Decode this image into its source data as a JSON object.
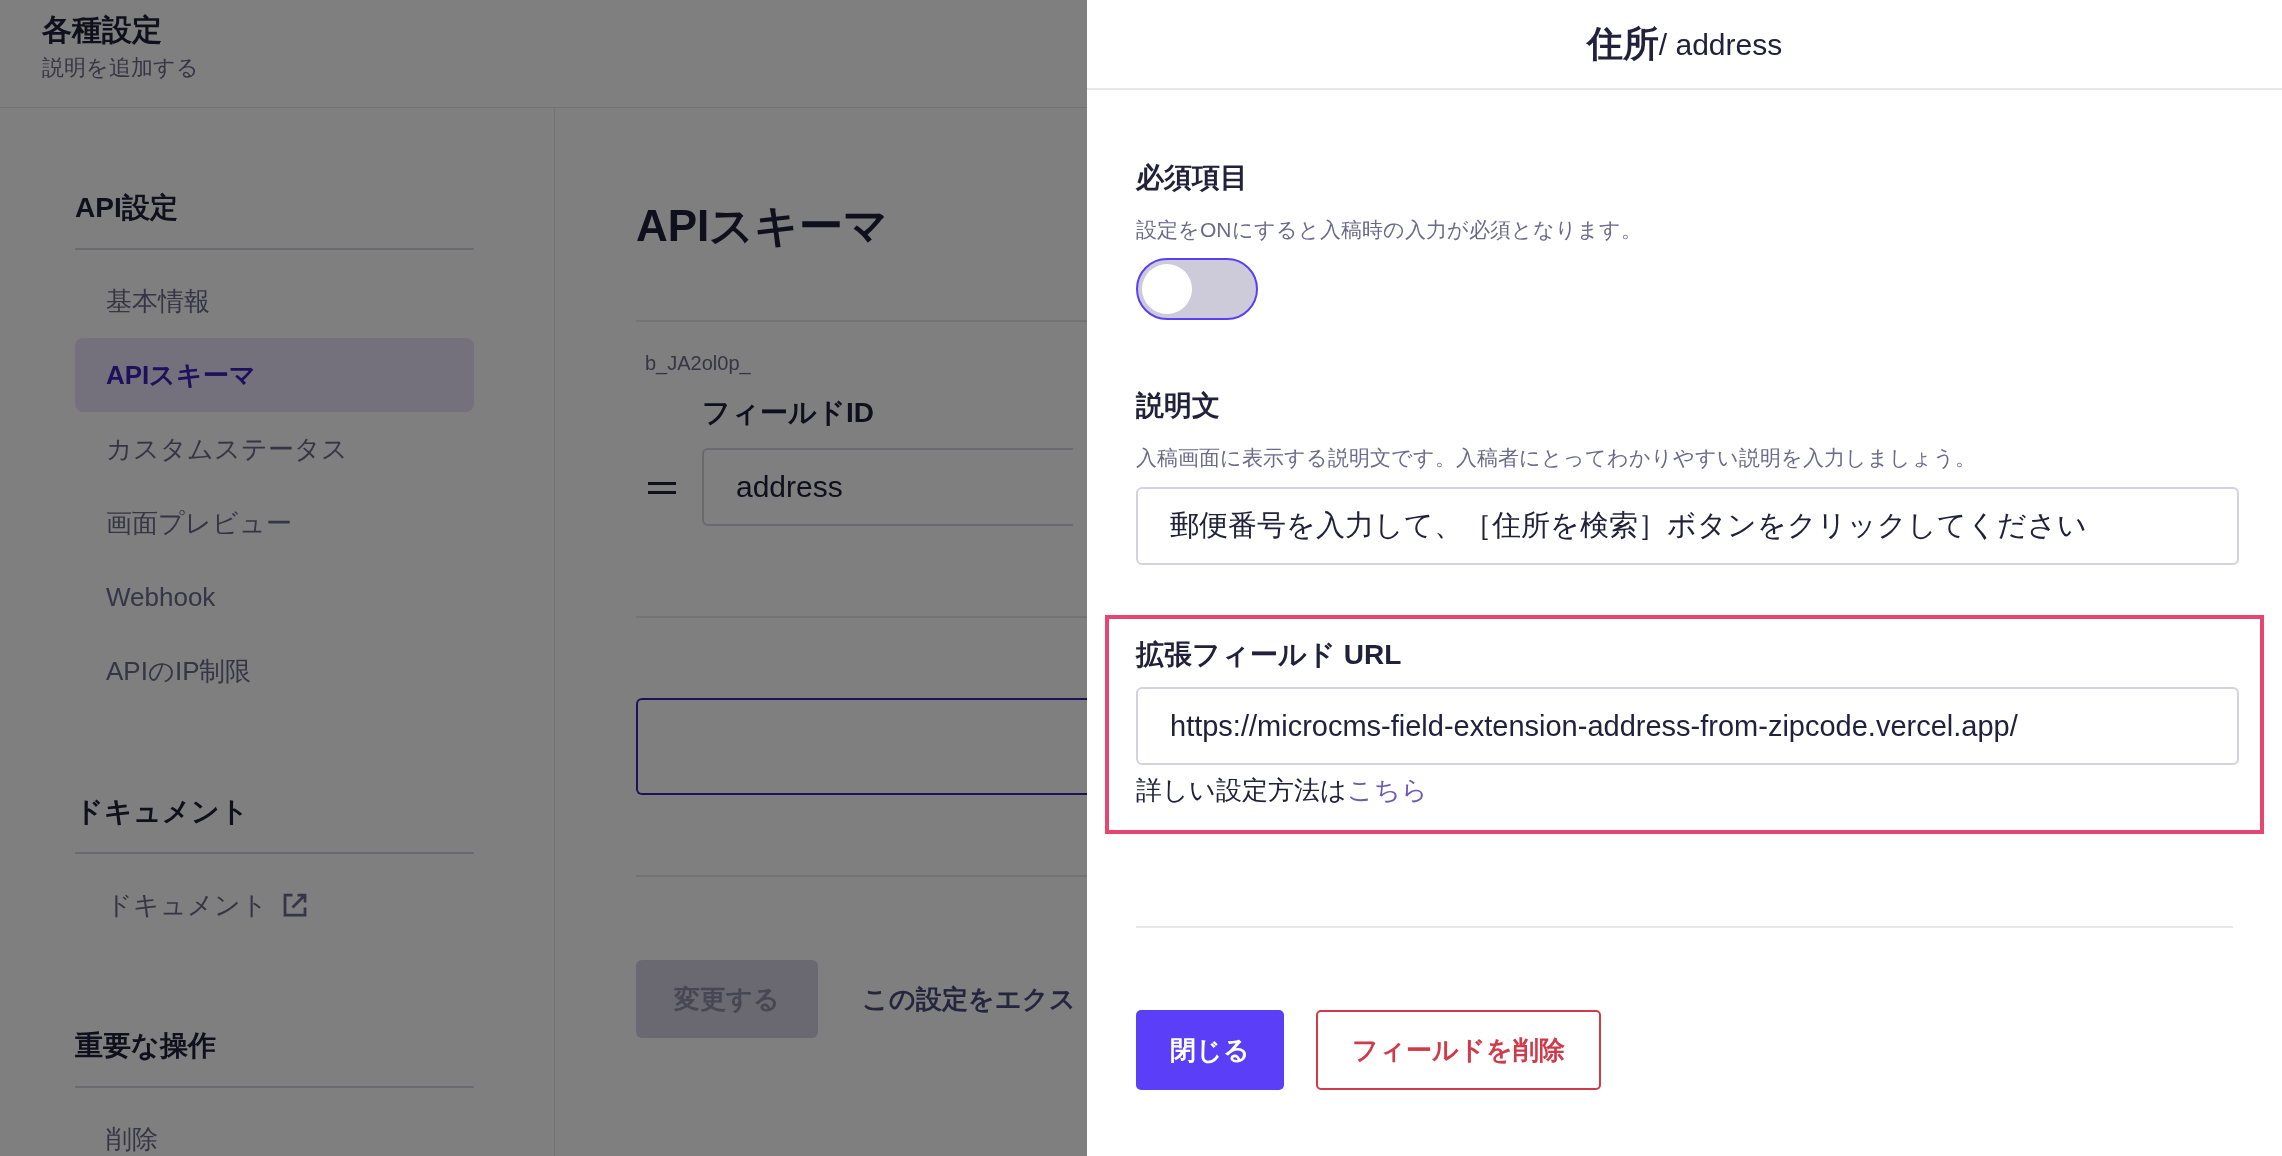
{
  "page": {
    "title": "各種設定",
    "subtitle": "説明を追加する"
  },
  "sidebar": {
    "sections": [
      {
        "heading": "API設定",
        "items": [
          {
            "label": "基本情報",
            "selected": false
          },
          {
            "label": "APIスキーマ",
            "selected": true
          },
          {
            "label": "カスタムステータス",
            "selected": false
          },
          {
            "label": "画面プレビュー",
            "selected": false
          },
          {
            "label": "Webhook",
            "selected": false
          },
          {
            "label": "APIのIP制限",
            "selected": false
          }
        ]
      },
      {
        "heading": "ドキュメント",
        "items": [
          {
            "label": "ドキュメント",
            "selected": false,
            "external": true
          }
        ]
      },
      {
        "heading": "重要な操作",
        "items": [
          {
            "label": "削除",
            "selected": false
          }
        ]
      }
    ]
  },
  "main": {
    "title": "APIスキーマ",
    "field_key": "b_JA2ol0p_",
    "field_id_label": "フィールドID",
    "field_id_value": "address",
    "save_button": {
      "label": "変更する",
      "disabled": true
    },
    "export_link": "この設定をエクス"
  },
  "drawer": {
    "title": "**住所**/ address",
    "sections": [
      {
        "kind": "toggle",
        "label": "必須項目",
        "description": "設定をONにすると入稿時の入力が必須となります。",
        "on": false
      },
      {
        "kind": "text",
        "label": "説明文",
        "description": "入稿画面に表示する説明文です。入稿者にとってわかりやすい説明を入力しましょう。",
        "value": "郵便番号を入力して、［住所を検索］ボタンをクリックしてください"
      },
      {
        "kind": "url",
        "label": "拡張フィールド URL",
        "value": "https://microcms-field-extension-address-from-zipcode.vercel.app/",
        "help": "詳しい設定方法は",
        "help_link": "こちら",
        "highlighted": true
      }
    ],
    "buttons": [
      {
        "label": "閉じる",
        "kind": "primary"
      },
      {
        "label": "フィールドを削除",
        "kind": "danger"
      }
    ]
  }
}
